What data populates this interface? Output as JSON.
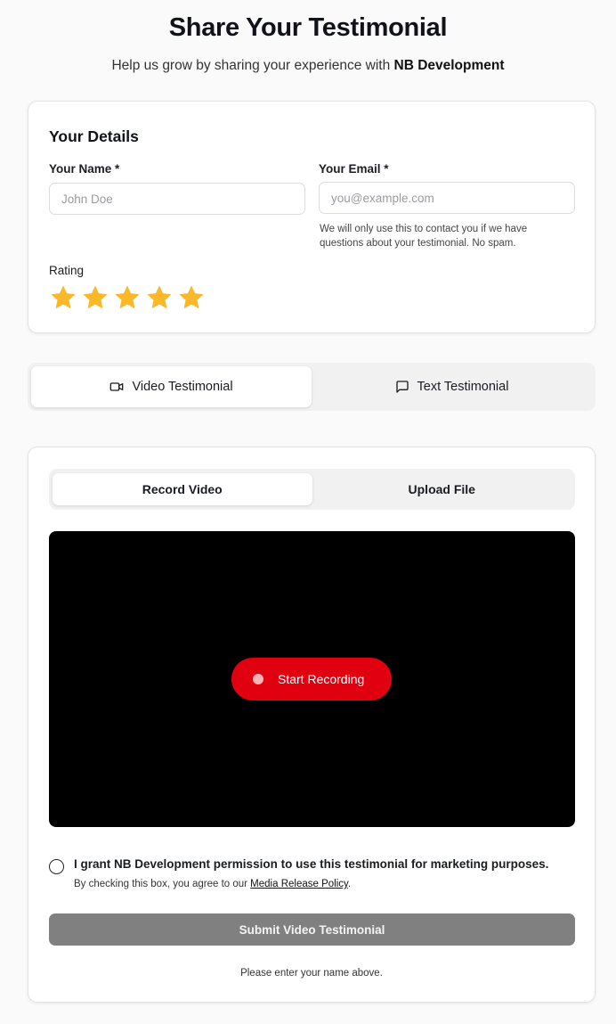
{
  "header": {
    "title": "Share Your Testimonial",
    "subtitle_prefix": "Help us grow by sharing your experience with ",
    "company": "NB Development"
  },
  "details": {
    "title": "Your Details",
    "name_label": "Your Name *",
    "name_placeholder": "John Doe",
    "email_label": "Your Email *",
    "email_placeholder": "you@example.com",
    "email_help": "We will only use this to contact you if we have questions about your testimonial. No spam.",
    "rating_label": "Rating",
    "rating_value": 5,
    "rating_max": 5,
    "star_color": "#fbb829"
  },
  "tabs": [
    {
      "label": "Video Testimonial",
      "icon": "video-camera-icon",
      "active": true
    },
    {
      "label": "Text Testimonial",
      "icon": "message-square-icon",
      "active": false
    }
  ],
  "video": {
    "subtabs": [
      {
        "label": "Record Video",
        "active": true
      },
      {
        "label": "Upload File",
        "active": false
      }
    ],
    "record_label": "Start Recording",
    "record_color": "#e1000f"
  },
  "consent": {
    "text_prefix": "I grant ",
    "company": "NB Development",
    "text_suffix": " permission to use this testimonial for marketing purposes.",
    "sub_prefix": "By checking this box, you agree to our ",
    "policy_link": "Media Release Policy",
    "sub_suffix": "."
  },
  "submit": {
    "label": "Submit Video Testimonial",
    "note": "Please enter your name above."
  }
}
